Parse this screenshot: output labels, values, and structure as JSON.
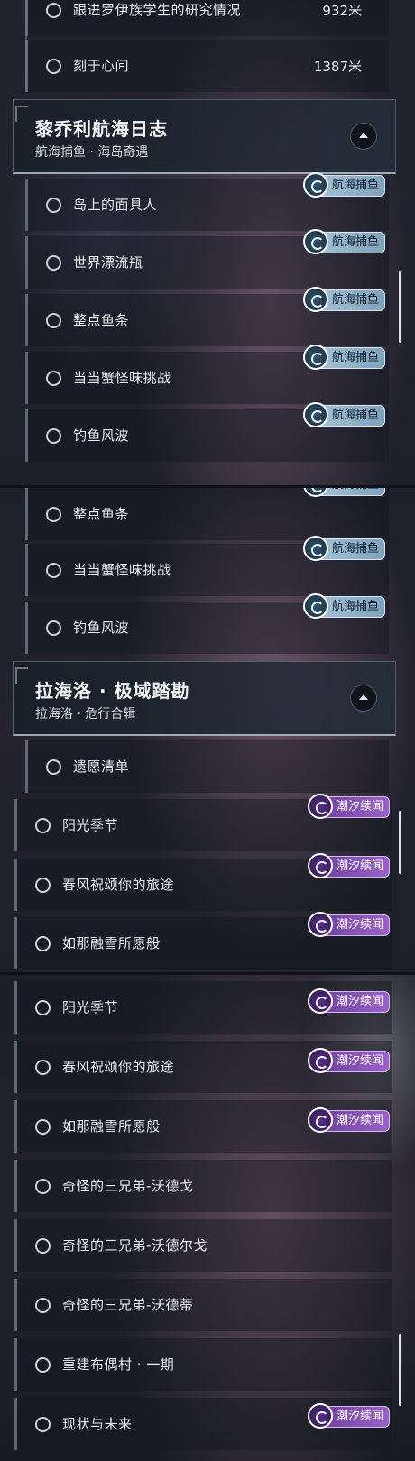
{
  "badges": {
    "sea": "航海捕鱼",
    "tide": "潮汐续闻"
  },
  "sec1": {
    "top_items": [
      {
        "label": "跟进罗伊族学生的研究情况",
        "distance": "932米"
      },
      {
        "label": "刻于心间",
        "distance": "1387米"
      }
    ],
    "chapter": {
      "title": "黎乔利航海日志",
      "subtitle": "航海捕鱼 · 海岛奇遇"
    },
    "items": [
      "岛上的面具人",
      "世界漂流瓶",
      "整点鱼条",
      "当当蟹怪味挑战",
      "钓鱼风波"
    ]
  },
  "sec2": {
    "items": [
      "整点鱼条",
      "当当蟹怪味挑战",
      "钓鱼风波"
    ],
    "chapter": {
      "title": "拉海洛 · 极域踏勘",
      "subtitle": "拉海洛 · 危行合辑"
    },
    "item_plain": "遗愿清单",
    "items_tide": [
      "阳光季节",
      "春风祝颂你的旅途",
      "如那融雪所愿般"
    ]
  },
  "sec3": {
    "items": [
      "阳光季节",
      "春风祝颂你的旅途",
      "如那融雪所愿般",
      "奇怪的三兄弟-沃德戈",
      "奇怪的三兄弟-沃德尔戈",
      "奇怪的三兄弟-沃德蒂",
      "重建布偶村 · 一期",
      "现状与未来"
    ]
  }
}
